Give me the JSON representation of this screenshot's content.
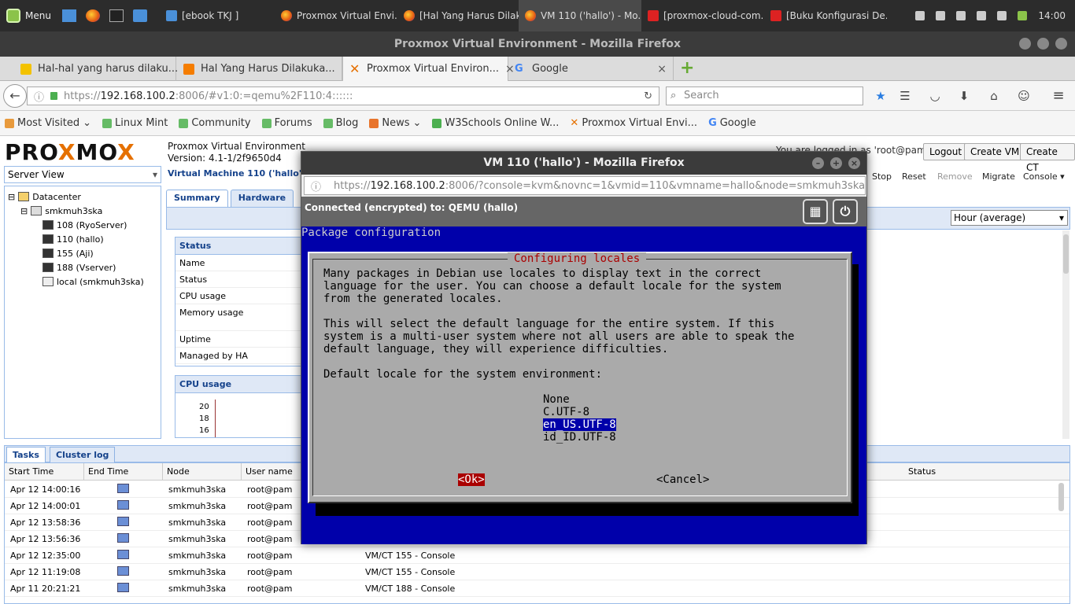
{
  "taskbar": {
    "menu_label": "Menu",
    "tasks": [
      {
        "label": "[ebook TKJ ]",
        "icon": "folder-icon"
      },
      {
        "label": "Proxmox Virtual Envi...",
        "icon": "firefox-icon"
      },
      {
        "label": "[Hal Yang Harus Dilak...",
        "icon": "firefox-icon"
      },
      {
        "label": "VM 110 ('hallo') - Mo...",
        "icon": "firefox-icon"
      },
      {
        "label": "[proxmox-cloud-com...",
        "icon": "pdf-icon"
      },
      {
        "label": "[Buku Konfigurasi De...",
        "icon": "pdf-icon"
      }
    ],
    "clock": "14:00"
  },
  "browser": {
    "window_title": "Proxmox Virtual Environment - Mozilla Firefox",
    "tabs": [
      {
        "label": "Hal-hal yang harus dilaku..."
      },
      {
        "label": "Hal Yang Harus Dilakuka..."
      },
      {
        "label": "Proxmox Virtual Environ..."
      },
      {
        "label": "Google"
      }
    ],
    "url_scheme": "https://",
    "url_host": "192.168.100.2",
    "url_rest": ":8006/#v1:0:=qemu%2F110:4::::::",
    "search_placeholder": "Search",
    "bookmarks": [
      "Most Visited",
      "Linux Mint",
      "Community",
      "Forums",
      "Blog",
      "News",
      "W3Schools Online W...",
      "Proxmox Virtual Envi...",
      "Google"
    ]
  },
  "proxmox": {
    "logo_a": "PRO",
    "logo_x": "X",
    "logo_b": "MO",
    "logo_x2": "X",
    "product": "Proxmox Virtual Environment",
    "version": "Version: 4.1-1/2f9650d4",
    "logged_in": "You are logged in as 'root@pam'",
    "buttons": {
      "logout": "Logout",
      "create_vm": "Create VM",
      "create_ct": "Create CT"
    },
    "view": "Server View",
    "tree": [
      {
        "label": "Datacenter",
        "level": 0
      },
      {
        "label": "smkmuh3ska",
        "level": 1
      },
      {
        "label": "108 (RyoServer)",
        "level": 2
      },
      {
        "label": "110 (hallo)",
        "level": 2
      },
      {
        "label": "155 (Aji)",
        "level": 2
      },
      {
        "label": "188 (Vserver)",
        "level": 2
      },
      {
        "label": "local (smkmuh3ska)",
        "level": 2
      }
    ],
    "vm_header": "Virtual Machine 110 ('hallo') on",
    "vm_tools": {
      "stop": "Stop",
      "reset": "Reset",
      "remove": "Remove",
      "migrate": "Migrate",
      "console": "Console"
    },
    "page_tabs": [
      "Summary",
      "Hardware"
    ],
    "timeframe": "Hour (average)",
    "status_panel": {
      "title": "Status",
      "rows": [
        "Name",
        "Status",
        "CPU usage",
        "Memory usage",
        "Uptime",
        "Managed by HA"
      ]
    },
    "cpu_panel": {
      "title": "CPU usage",
      "ticks": [
        "20",
        "18",
        "16"
      ]
    },
    "bottom_tabs": [
      "Tasks",
      "Cluster log"
    ],
    "task_columns": [
      "Start Time",
      "End Time",
      "Node",
      "User name",
      "Status"
    ],
    "tasks": [
      {
        "start": "Apr 12 14:00:16",
        "node": "smkmuh3ska",
        "user": "root@pam",
        "desc": ""
      },
      {
        "start": "Apr 12 14:00:01",
        "node": "smkmuh3ska",
        "user": "root@pam",
        "desc": ""
      },
      {
        "start": "Apr 12 13:58:36",
        "node": "smkmuh3ska",
        "user": "root@pam",
        "desc": ""
      },
      {
        "start": "Apr 12 13:56:36",
        "node": "smkmuh3ska",
        "user": "root@pam",
        "desc": ""
      },
      {
        "start": "Apr 12 12:35:00",
        "node": "smkmuh3ska",
        "user": "root@pam",
        "desc": "VM/CT 155 - Console"
      },
      {
        "start": "Apr 12 11:19:08",
        "node": "smkmuh3ska",
        "user": "root@pam",
        "desc": "VM/CT 155 - Console"
      },
      {
        "start": "Apr 11 20:21:21",
        "node": "smkmuh3ska",
        "user": "root@pam",
        "desc": "VM/CT 188 - Console"
      }
    ]
  },
  "console": {
    "window_title": "VM 110 ('hallo') - Mozilla Firefox",
    "url_scheme": "https://",
    "url_host": "192.168.100.2",
    "url_rest": ":8006/?console=kvm&novnc=1&vmid=110&vmname=hallo&node=smkmuh3ska",
    "status": "Connected (encrypted) to: QEMU (hallo)",
    "screen_header": "Package configuration",
    "dialog_title": "Configuring locales",
    "lines": [
      "Many packages in Debian use locales to display text in the correct",
      "language for the user. You can choose a default locale for the system",
      "from the generated locales.",
      "",
      "This will select the default language for the entire system. If this",
      "system is a multi-user system where not all users are able to speak the",
      "default language, they will experience difficulties.",
      "",
      "Default locale for the system environment:"
    ],
    "options": [
      "None",
      "C.UTF-8",
      "en_US.UTF-8",
      "id_ID.UTF-8"
    ],
    "selected_option": "en_US.UTF-8",
    "ok": "<Ok>",
    "cancel": "<Cancel>"
  }
}
